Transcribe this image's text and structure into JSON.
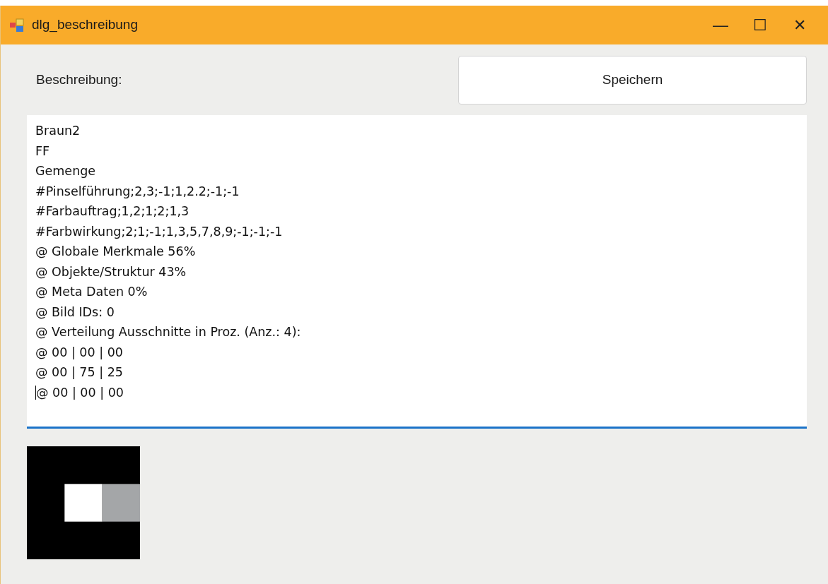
{
  "window": {
    "title": "dlg_beschreibung",
    "controls": [
      "—",
      "☐",
      "✕"
    ]
  },
  "label": "Beschreibung:",
  "save_button": "Speichern",
  "text_area": {
    "focused": true,
    "lines": [
      "Braun2",
      "FF",
      "Gemenge",
      "#Pinselführung;2,3;-1;1,2.2;-1;-1",
      "#Farbauftrag;1,2;1;2;1,3",
      "#Farbwirkung;2;1;-1;1,3,5,7,8,9;-1;-1;-1",
      "@ Globale Merkmale 56%",
      "@ Objekte/Struktur 43%",
      "@ Meta Daten 0%",
      "@ Bild IDs: 0",
      "@ Verteilung Ausschnitte in Proz. (Anz.: 4):",
      "@ 00 | 00 | 00",
      "@ 00 | 75 | 25",
      "@ 00 | 00 | 00"
    ]
  }
}
